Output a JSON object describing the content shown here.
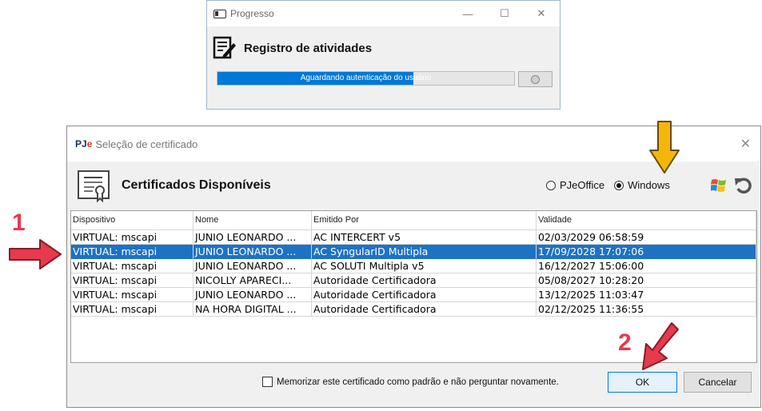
{
  "progress_window": {
    "title": "Progresso",
    "heading": "Registro de atividades",
    "status_text": "Aguardando autenticação do usuário",
    "progress_fraction": 0.66
  },
  "cert_dialog": {
    "logo_prefix": "PJ",
    "logo_suffix": "e",
    "title": "Seleção de certificado",
    "heading": "Certificados Disponíveis",
    "radio_pjeoffice": "PJeOffice",
    "radio_windows": "Windows",
    "selected_source": "Windows",
    "columns": [
      "Dispositivo",
      "Nome",
      "Emitido Por",
      "Validade"
    ],
    "rows": [
      {
        "dispositivo": "VIRTUAL: mscapi",
        "nome": "JUNIO LEONARDO ...",
        "emitido": "AC INTERCERT v5",
        "validade": "02/03/2029 06:58:59"
      },
      {
        "dispositivo": "VIRTUAL: mscapi",
        "nome": "JUNIO LEONARDO ...",
        "emitido": "AC SyngularID Multipla",
        "validade": "17/09/2028 17:07:06"
      },
      {
        "dispositivo": "VIRTUAL: mscapi",
        "nome": "JUNIO LEONARDO ...",
        "emitido": "AC SOLUTI Multipla v5",
        "validade": "16/12/2027 15:06:00"
      },
      {
        "dispositivo": "VIRTUAL: mscapi",
        "nome": "NICOLLY APARECI...",
        "emitido": "Autoridade Certificadora",
        "validade": "05/08/2027 10:28:20"
      },
      {
        "dispositivo": "VIRTUAL: mscapi",
        "nome": "JUNIO LEONARDO ...",
        "emitido": "Autoridade Certificadora",
        "validade": "13/12/2025 11:03:47"
      },
      {
        "dispositivo": "VIRTUAL: mscapi",
        "nome": "NA HORA DIGITAL ...",
        "emitido": "Autoridade Certificadora",
        "validade": "02/12/2025 11:36:55"
      }
    ],
    "selected_row": 1,
    "remember_label": "Memorizar este certificado como padrão e não perguntar novamente.",
    "ok_label": "OK",
    "cancel_label": "Cancelar"
  },
  "annotations": {
    "step1": "1",
    "step2": "2",
    "arrow_red": "#e63a4d",
    "arrow_yellow": "#f5b60a"
  },
  "colors": {
    "selection": "#1e72c4",
    "progress_fill": "#0078d7"
  }
}
